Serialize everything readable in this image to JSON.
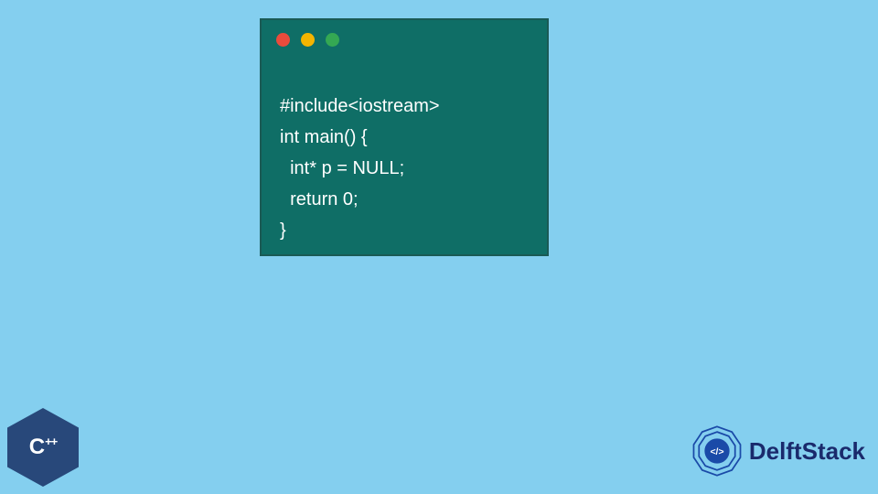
{
  "code_window": {
    "lines": [
      "#include<iostream>",
      "int main() {",
      "  int* p = NULL;",
      "  return 0;",
      "}"
    ],
    "traffic_colors": {
      "red": "#e94b3c",
      "yellow": "#f4b400",
      "green": "#34a853"
    }
  },
  "badges": {
    "cpp_label_main": "C",
    "cpp_label_plus": "++"
  },
  "brand": {
    "name": "DelftStack",
    "logo_icon": "code-brackets-icon"
  },
  "colors": {
    "background": "#84cfef",
    "window_bg": "#0f6e66",
    "code_text": "#ffffff",
    "brand_text": "#1a2a6c",
    "cpp_hex": "#28487a"
  }
}
